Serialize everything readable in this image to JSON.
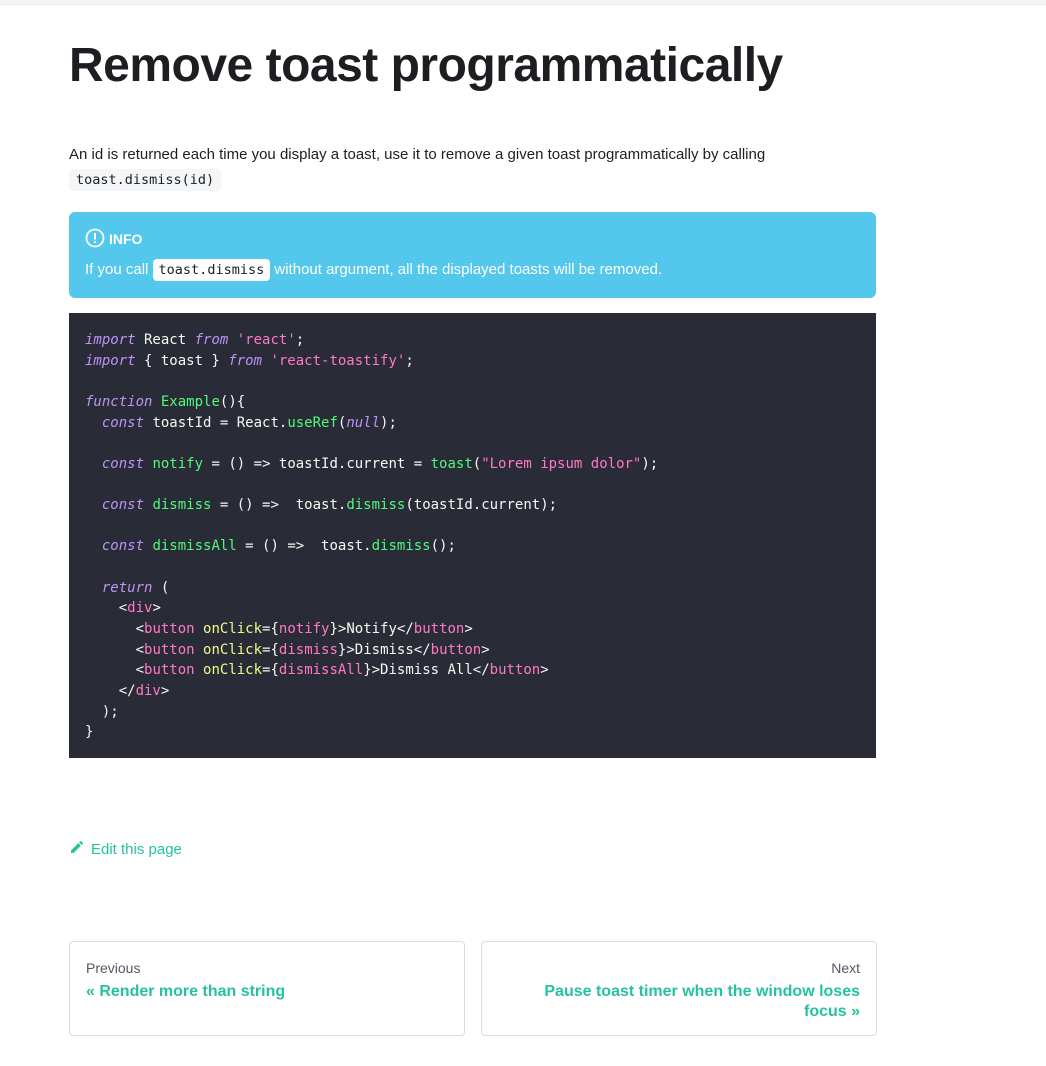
{
  "page": {
    "title": "Remove toast programmatically",
    "intro_text": "An id is returned each time you display a toast, use it to remove a given toast programmatically by calling",
    "intro_code": "toast.dismiss(id)"
  },
  "admonition": {
    "heading": "INFO",
    "text_before": "If you call",
    "code": "toast.dismiss",
    "text_after": "without argument, all the displayed toasts will be removed.",
    "color": "#54c7ec",
    "icon": "info-icon"
  },
  "code": {
    "language": "jsx",
    "lines": [
      [
        [
          "kw",
          "import"
        ],
        [
          "plain",
          " React "
        ],
        [
          "kw",
          "from"
        ],
        [
          "plain",
          " "
        ],
        [
          "str",
          "'react'"
        ],
        [
          "plain",
          ";"
        ]
      ],
      [
        [
          "kw",
          "import"
        ],
        [
          "plain",
          " { toast } "
        ],
        [
          "kw",
          "from"
        ],
        [
          "plain",
          " "
        ],
        [
          "str",
          "'react-toastify'"
        ],
        [
          "plain",
          ";"
        ]
      ],
      [],
      [
        [
          "kw",
          "function"
        ],
        [
          "plain",
          " "
        ],
        [
          "fn",
          "Example"
        ],
        [
          "plain",
          "(){"
        ]
      ],
      [
        [
          "plain",
          "  "
        ],
        [
          "kw",
          "const"
        ],
        [
          "plain",
          " toastId = React."
        ],
        [
          "fn",
          "useRef"
        ],
        [
          "plain",
          "("
        ],
        [
          "kw",
          "null"
        ],
        [
          "plain",
          ");"
        ]
      ],
      [],
      [
        [
          "plain",
          "  "
        ],
        [
          "kw",
          "const"
        ],
        [
          "plain",
          " "
        ],
        [
          "fn",
          "notify"
        ],
        [
          "plain",
          " = () => toastId.current = "
        ],
        [
          "fn",
          "toast"
        ],
        [
          "plain",
          "("
        ],
        [
          "str",
          "\"Lorem ipsum dolor\""
        ],
        [
          "plain",
          ");"
        ]
      ],
      [],
      [
        [
          "plain",
          "  "
        ],
        [
          "kw",
          "const"
        ],
        [
          "plain",
          " "
        ],
        [
          "fn",
          "dismiss"
        ],
        [
          "plain",
          " = () =>  toast."
        ],
        [
          "fn",
          "dismiss"
        ],
        [
          "plain",
          "(toastId.current);"
        ]
      ],
      [],
      [
        [
          "plain",
          "  "
        ],
        [
          "kw",
          "const"
        ],
        [
          "plain",
          " "
        ],
        [
          "fn",
          "dismissAll"
        ],
        [
          "plain",
          " = () =>  toast."
        ],
        [
          "fn",
          "dismiss"
        ],
        [
          "plain",
          "();"
        ]
      ],
      [],
      [
        [
          "plain",
          "  "
        ],
        [
          "kw",
          "return"
        ],
        [
          "plain",
          " ("
        ]
      ],
      [
        [
          "plain",
          "    <"
        ],
        [
          "tag",
          "div"
        ],
        [
          "plain",
          ">"
        ]
      ],
      [
        [
          "plain",
          "      <"
        ],
        [
          "tag",
          "button"
        ],
        [
          "plain",
          " "
        ],
        [
          "attr",
          "onClick"
        ],
        [
          "plain",
          "={"
        ],
        [
          "str",
          "notify"
        ],
        [
          "plain",
          "}>Notify</"
        ],
        [
          "tag",
          "button"
        ],
        [
          "plain",
          ">"
        ]
      ],
      [
        [
          "plain",
          "      <"
        ],
        [
          "tag",
          "button"
        ],
        [
          "plain",
          " "
        ],
        [
          "attr",
          "onClick"
        ],
        [
          "plain",
          "={"
        ],
        [
          "str",
          "dismiss"
        ],
        [
          "plain",
          "}>Dismiss</"
        ],
        [
          "tag",
          "button"
        ],
        [
          "plain",
          ">"
        ]
      ],
      [
        [
          "plain",
          "      <"
        ],
        [
          "tag",
          "button"
        ],
        [
          "plain",
          " "
        ],
        [
          "attr",
          "onClick"
        ],
        [
          "plain",
          "={"
        ],
        [
          "str",
          "dismissAll"
        ],
        [
          "plain",
          "}>Dismiss All</"
        ],
        [
          "tag",
          "button"
        ],
        [
          "plain",
          ">"
        ]
      ],
      [
        [
          "plain",
          "    </"
        ],
        [
          "tag",
          "div"
        ],
        [
          "plain",
          ">"
        ]
      ],
      [
        [
          "plain",
          "  );"
        ]
      ],
      [
        [
          "plain",
          "}"
        ]
      ]
    ]
  },
  "edit": {
    "label": "Edit this page",
    "icon": "pencil-icon"
  },
  "pagination": {
    "previous": {
      "sublabel": "Previous",
      "label": "« Render more than string"
    },
    "next": {
      "sublabel": "Next",
      "label": "Pause toast timer when the window loses focus »"
    }
  },
  "colors": {
    "accent": "#25c2a0",
    "code_bg": "#292b36",
    "info_bg": "#54c7ec"
  }
}
